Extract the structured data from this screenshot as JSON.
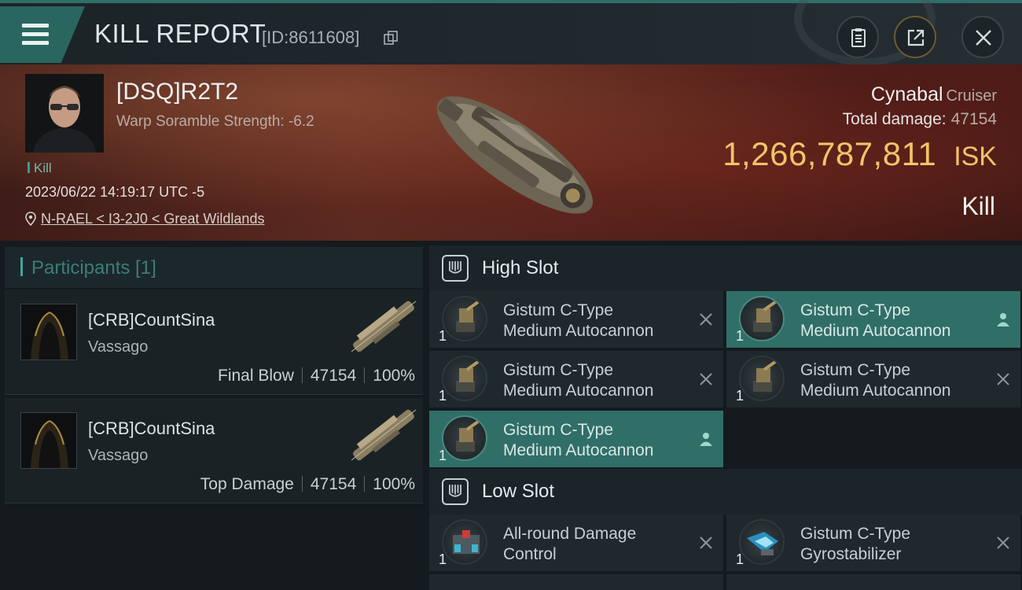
{
  "header": {
    "title": "KILL REPORT",
    "report_id": "[ID:8611608]",
    "buttons": [
      "clipboard-icon",
      "share-icon",
      "close-icon"
    ]
  },
  "victim": {
    "name": "[DSQ]R2T2",
    "scramble": "Warp Soramble Strength: -6.2",
    "tag": "Kill",
    "datetime": "2023/06/22 14:19:17 UTC -5",
    "location": "N-RAEL < I3-2J0 < Great Wildlands",
    "ship_name": "Cynabal",
    "ship_class": "Cruiser",
    "total_damage_label": "Total damage:",
    "total_damage": "47154",
    "isk_value": "1,266,787,811",
    "isk_unit": "ISK",
    "result": "Kill"
  },
  "participants": {
    "label": "Participants [1]",
    "items": [
      {
        "name": "[CRB]CountSina",
        "ship": "Vassago",
        "role": "Final Blow",
        "damage": "47154",
        "pct": "100%"
      },
      {
        "name": "[CRB]CountSina",
        "ship": "Vassago",
        "role": "Top Damage",
        "damage": "47154",
        "pct": "100%"
      }
    ]
  },
  "slots": {
    "high_label": "High Slot",
    "low_label": "Low Slot",
    "high": [
      {
        "l1": "Gistum C-Type",
        "l2": "Medium Autocannon",
        "qty": "1",
        "state": "destroyed"
      },
      {
        "l1": "Gistum C-Type",
        "l2": "Medium Autocannon",
        "qty": "1",
        "state": "dropped"
      },
      {
        "l1": "Gistum C-Type",
        "l2": "Medium Autocannon",
        "qty": "1",
        "state": "destroyed"
      },
      {
        "l1": "Gistum C-Type",
        "l2": "Medium Autocannon",
        "qty": "1",
        "state": "destroyed"
      },
      {
        "l1": "Gistum C-Type",
        "l2": "Medium Autocannon",
        "qty": "1",
        "state": "dropped"
      }
    ],
    "low": [
      {
        "l1": "All-round Damage",
        "l2": "Control",
        "qty": "1",
        "state": "destroyed"
      },
      {
        "l1": "Gistum C-Type",
        "l2": "Gyrostabilizer",
        "qty": "1",
        "state": "destroyed"
      }
    ]
  },
  "colors": {
    "accent": "#2f6f68",
    "isk": "#f3c36a",
    "banner": "#4b1e18"
  }
}
